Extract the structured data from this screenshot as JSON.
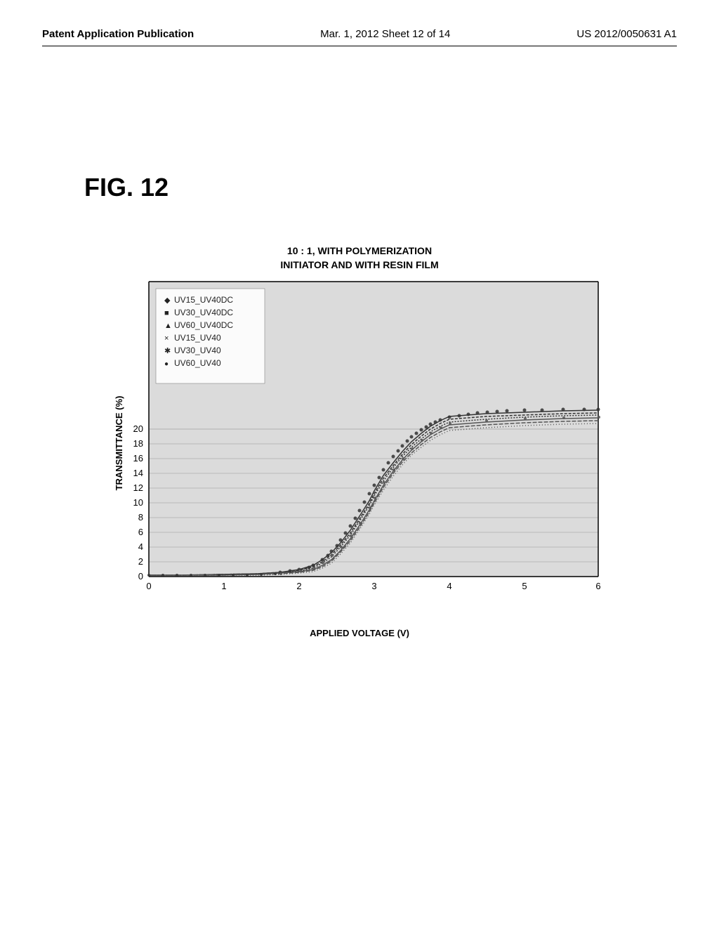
{
  "header": {
    "left": "Patent Application Publication",
    "center": "Mar. 1, 2012  Sheet 12 of 14",
    "right": "US 2012/0050631 A1"
  },
  "figure": {
    "label": "FIG. 12"
  },
  "chart": {
    "title_line1": "10 : 1, WITH POLYMERIZATION",
    "title_line2": "INITIATOR AND WITH RESIN FILM",
    "y_axis_label": "TRANSMITTANCE (%)",
    "x_axis_label": "APPLIED VOLTAGE (V)",
    "y_ticks": [
      0,
      2,
      4,
      6,
      8,
      10,
      12,
      14,
      16,
      18,
      20
    ],
    "x_ticks": [
      0,
      1,
      2,
      3,
      4,
      5,
      6
    ],
    "legend": [
      {
        "symbol": "◆",
        "label": "UV15_UV40DC"
      },
      {
        "symbol": "■",
        "label": "UV30_UV40DC"
      },
      {
        "symbol": "▲",
        "label": "UV60_UV40DC"
      },
      {
        "symbol": "×",
        "label": "UV15_UV40"
      },
      {
        "symbol": "✱",
        "label": "UV30_UV40"
      },
      {
        "symbol": "●",
        "label": "UV60_UV40"
      }
    ]
  }
}
